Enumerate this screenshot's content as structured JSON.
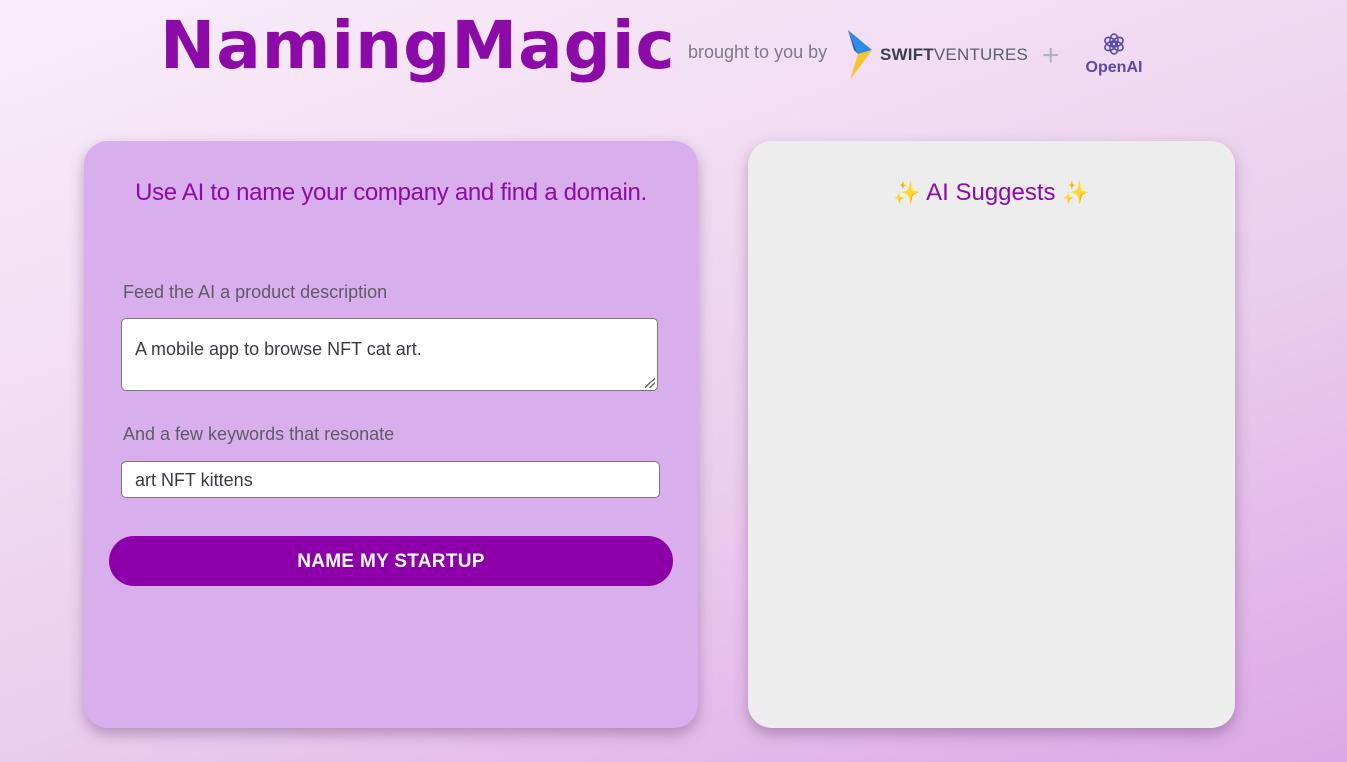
{
  "header": {
    "title": "NamingMagic",
    "brought_by": "brought to you by",
    "sponsor_swift_bold": "SWIFT",
    "sponsor_swift_rest": "VENTURES",
    "plus": "+",
    "sponsor_openai": "OpenAI"
  },
  "form": {
    "tagline": "Use AI to name your company and find a domain.",
    "description_label": "Feed the AI a product description",
    "description_value": "A mobile app to browse NFT cat art.",
    "keywords_label": "And a few keywords that resonate",
    "keywords_value": "art NFT kittens",
    "submit_label": "NAME MY STARTUP"
  },
  "results": {
    "sparkle_left": "✨",
    "title": "AI Suggests",
    "sparkle_right": "✨"
  },
  "colors": {
    "brand_purple": "#8c0aa8",
    "button_purple": "#8d00a9",
    "form_card": "#d8aeed",
    "results_card": "#eeedee",
    "sparkle": "#f2b62c"
  },
  "icons": [
    "swift-ventures-logo-icon",
    "openai-logo-icon",
    "sparkle-icon"
  ]
}
